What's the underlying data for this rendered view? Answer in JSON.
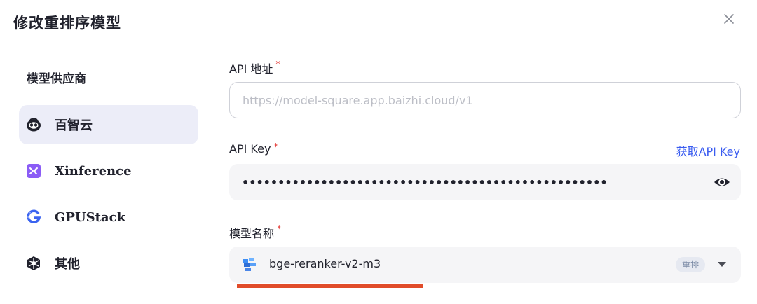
{
  "dialog": {
    "title": "修改重排序模型"
  },
  "sidebar": {
    "heading": "模型供应商",
    "providers": [
      {
        "label": "百智云",
        "icon": "baizhi-cloud-icon",
        "active": true
      },
      {
        "label": "Xinference",
        "icon": "xinference-icon",
        "active": false
      },
      {
        "label": "GPUStack",
        "icon": "gpustack-icon",
        "active": false
      },
      {
        "label": "其他",
        "icon": "other-provider-icon",
        "active": false
      }
    ]
  },
  "form": {
    "api_address": {
      "label": "API 地址",
      "required_mark": "*",
      "placeholder": "https://model-square.app.baizhi.cloud/v1",
      "value": ""
    },
    "api_key": {
      "label": "API Key",
      "required_mark": "*",
      "link": "获取API Key",
      "masked_value": "•••••••••••••••••••••••••••••••••••••••••••••••••••"
    },
    "model_name": {
      "label": "模型名称",
      "required_mark": "*",
      "value": "bge-reranker-v2-m3",
      "tag": "重排"
    }
  },
  "colors": {
    "accent_link": "#3a5cf0",
    "required": "#e53935",
    "active_item_bg": "#ecedf8",
    "highlight_underline": "#e14c2a"
  }
}
